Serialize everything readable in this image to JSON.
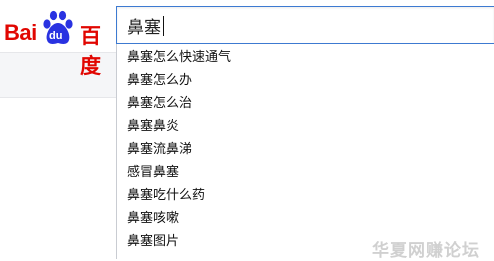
{
  "logo": {
    "text_latin": "Bai",
    "text_paw": "du",
    "text_cn": "百度",
    "brand_red": "#e10601",
    "brand_blue": "#2932e1"
  },
  "search": {
    "value": "鼻塞",
    "border_color": "#3d7ad1"
  },
  "suggestions": [
    "鼻塞怎么快速通气",
    "鼻塞怎么办",
    "鼻塞怎么治",
    "鼻塞鼻炎",
    "鼻塞流鼻涕",
    "感冒鼻塞",
    "鼻塞吃什么药",
    "鼻塞咳嗽",
    "鼻塞图片"
  ],
  "watermark": "华夏网赚论坛"
}
